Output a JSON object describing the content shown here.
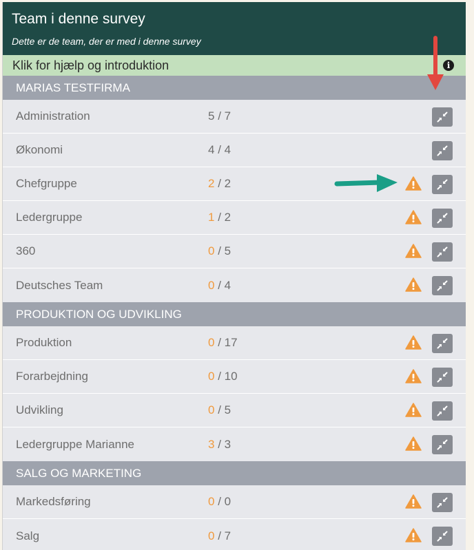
{
  "panel": {
    "title": "Team i denne survey",
    "subtitle": "Dette er de team, der er med i denne survey",
    "help_label": "Klik for hjælp og introduktion",
    "info_icon_glyph": "i"
  },
  "colors": {
    "header_bg": "#1f4a46",
    "help_bg": "#c3e0bd",
    "group_bg": "#9ea3ad",
    "warning": "#f09a3e",
    "annotation_red": "#e2473f",
    "annotation_green": "#1a9e87"
  },
  "icons": {
    "warning": "warning-triangle-icon",
    "collapse": "collapse-arrows-icon",
    "info": "info-circle-icon"
  },
  "groups": [
    {
      "name": "MARIAS TESTFIRMA",
      "teams": [
        {
          "name": "Administration",
          "answered": "5",
          "total": "7",
          "warning": false
        },
        {
          "name": "Økonomi",
          "answered": "4",
          "total": "4",
          "warning": false
        },
        {
          "name": "Chefgruppe",
          "answered": "2",
          "total": "2",
          "warning": true
        },
        {
          "name": "Ledergruppe",
          "answered": "1",
          "total": "2",
          "warning": true
        },
        {
          "name": "360",
          "answered": "0",
          "total": "5",
          "warning": true
        },
        {
          "name": "Deutsches Team",
          "answered": "0",
          "total": "4",
          "warning": true
        }
      ]
    },
    {
      "name": "PRODUKTION OG UDVIKLING",
      "teams": [
        {
          "name": "Produktion",
          "answered": "0",
          "total": "17",
          "warning": true
        },
        {
          "name": "Forarbejdning",
          "answered": "0",
          "total": "10",
          "warning": true
        },
        {
          "name": "Udvikling",
          "answered": "0",
          "total": "5",
          "warning": true
        },
        {
          "name": "Ledergruppe Marianne",
          "answered": "3",
          "total": "3",
          "warning": true
        }
      ]
    },
    {
      "name": "SALG OG MARKETING",
      "teams": [
        {
          "name": "Markedsføring",
          "answered": "0",
          "total": "0",
          "warning": true
        },
        {
          "name": "Salg",
          "answered": "0",
          "total": "7",
          "warning": true
        }
      ]
    }
  ]
}
